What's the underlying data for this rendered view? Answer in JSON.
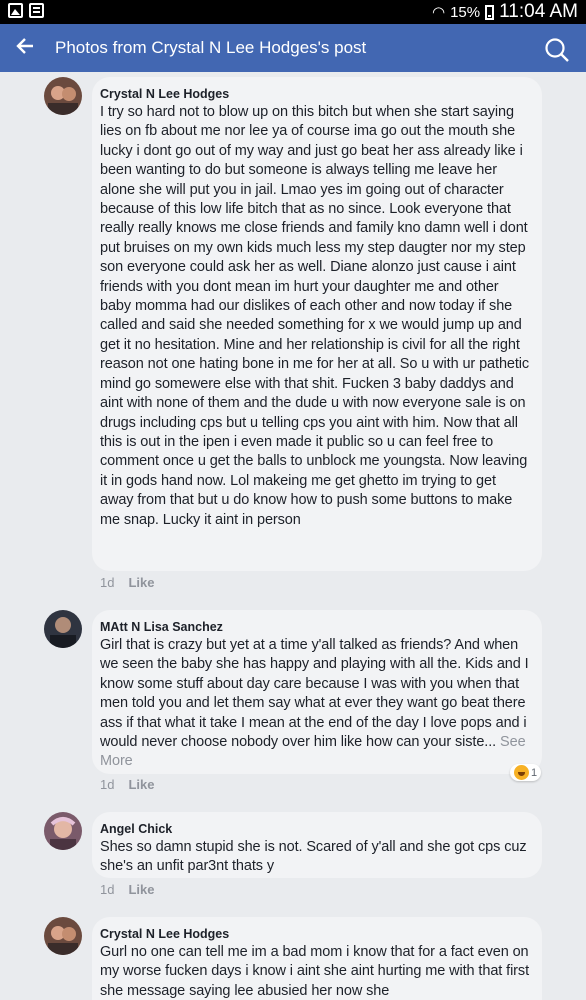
{
  "status_bar": {
    "battery": "15%",
    "time": "11:04 AM"
  },
  "app_bar": {
    "title": "Photos from Crystal N Lee Hodges's post",
    "back_icon": "back-arrow-icon",
    "search_icon": "search-icon"
  },
  "comments": [
    {
      "author": "Crystal N Lee Hodges",
      "text": "I try so hard not to blow up on this bitch but when she start saying lies on fb about me nor lee ya of course ima go out the mouth she lucky i dont go out of my way and just go beat her ass already like i been wanting to do but someone is always telling me leave her alone she will put you in jail. Lmao yes im going out of character because of this low life bitch that as no since. Look everyone that really really knows me close friends and family kno damn well i dont put bruises on my own kids much less my step daugter nor my step son everyone could ask her as well. Diane alonzo just cause i aint friends with you dont mean im hurt your daughter me and other baby momma had our dislikes of each other and now today if she called and said she needed something for x we would jump up and get it no hesitation. Mine and her relationship is civil for all the right reason not one hating bone in me for her at all. So u with ur pathetic mind go somewere else with that shit. Fucken 3 baby daddys and aint with none of them and the dude u with now everyone sale is on drugs including cps but u telling cps you aint with him. Now that all this is out in the ipen i even made it public so u can feel free to comment once u get the balls to unblock me youngsta. Now leaving it in gods hand now. Lol makeing me get ghetto im trying to get away from that but u do know how to push some buttons to make me snap. Lucky it aint in person",
      "time": "1d",
      "like": "Like"
    },
    {
      "author": "MAtt N Lisa Sanchez",
      "text": "Girl that is crazy but yet at a time y'all talked as friends? And when we seen the baby she has happy and playing with all the. Kids and I know some stuff about day care because I was with you when that men told you and let them say what at ever they want go beat there ass if that what it take I mean at the end of the day I love pops and i would never choose nobody over him like how can your siste...",
      "see_more": "See More",
      "time": "1d",
      "like": "Like",
      "reaction_count": "1",
      "reaction_icon": "haha-emoji-icon"
    },
    {
      "author": "Angel Chick",
      "text": "Shes so damn stupid she is not. Scared of y'all  and she got cps  cuz  she's  an  unfit par3nt thats y",
      "time": "1d",
      "like": "Like"
    },
    {
      "author": "Crystal N Lee Hodges",
      "text": "Gurl no one can tell me im a bad mom i know that for a fact even on my worse fucken days i know i aint she aint hurting me with that first she message saying lee abusied her now she"
    }
  ],
  "colors": {
    "app_bar": "#4267b2",
    "bubble": "#f2f3f5",
    "page_bg": "#e9ebee",
    "meta_text": "#90949c"
  }
}
